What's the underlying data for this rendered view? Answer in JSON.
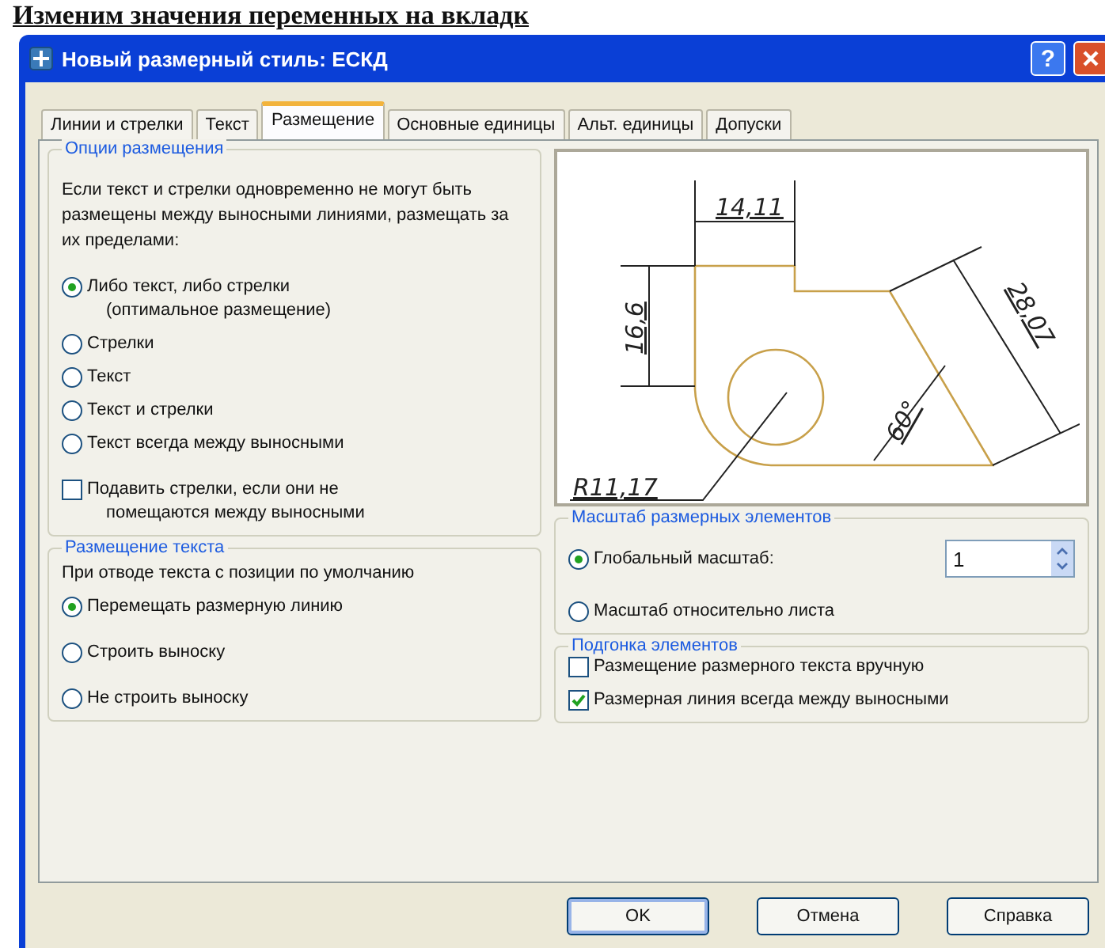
{
  "page_heading": "Изменим значения переменных на вкладк",
  "window": {
    "title": "Новый размерный стиль: ЕСКД",
    "help_button": "?"
  },
  "tabs": [
    {
      "label": "Линии и стрелки",
      "selected": false
    },
    {
      "label": "Текст",
      "selected": false
    },
    {
      "label": "Размещение",
      "selected": true
    },
    {
      "label": "Основные единицы",
      "selected": false
    },
    {
      "label": "Альт. единицы",
      "selected": false
    },
    {
      "label": "Допуски",
      "selected": false
    }
  ],
  "fit_options": {
    "title": "Опции размещения",
    "description": "Если текст и стрелки одновременно не могут быть размещены между выносными линиями, размещать за их пределами:",
    "options": [
      {
        "label": "Либо текст, либо стрелки",
        "note": "(оптимальное размещение)",
        "selected": true
      },
      {
        "label": "Стрелки",
        "selected": false
      },
      {
        "label": "Текст",
        "selected": false
      },
      {
        "label": "Текст и стрелки",
        "selected": false
      },
      {
        "label": "Текст всегда между выносными",
        "selected": false
      }
    ],
    "suppress": {
      "label": "Подавить стрелки, если они не",
      "note": "помещаются между выносными",
      "checked": false
    }
  },
  "text_placement": {
    "title": "Размещение текста",
    "description": "При отводе текста с позиции по умолчанию",
    "options": [
      {
        "label": "Перемещать размерную линию",
        "selected": true
      },
      {
        "label": "Строить выноску",
        "selected": false
      },
      {
        "label": "Не строить выноску",
        "selected": false
      }
    ]
  },
  "preview": {
    "labels": [
      "14,11",
      "16,6",
      "28,07",
      "60°",
      "R11,17"
    ]
  },
  "scale": {
    "title": "Масштаб размерных элементов",
    "options": [
      {
        "label": "Глобальный масштаб:",
        "selected": true,
        "value": "1"
      },
      {
        "label": "Масштаб относительно листа",
        "selected": false
      }
    ]
  },
  "fine_tuning": {
    "title": "Подгонка элементов",
    "options": [
      {
        "label": "Размещение размерного текста вручную",
        "checked": false
      },
      {
        "label": "Размерная линия всегда между выносными",
        "checked": true
      }
    ]
  },
  "buttons": [
    {
      "label": "OK",
      "default": true
    },
    {
      "label": "Отмена",
      "default": false
    },
    {
      "label": "Справка",
      "default": false
    }
  ]
}
